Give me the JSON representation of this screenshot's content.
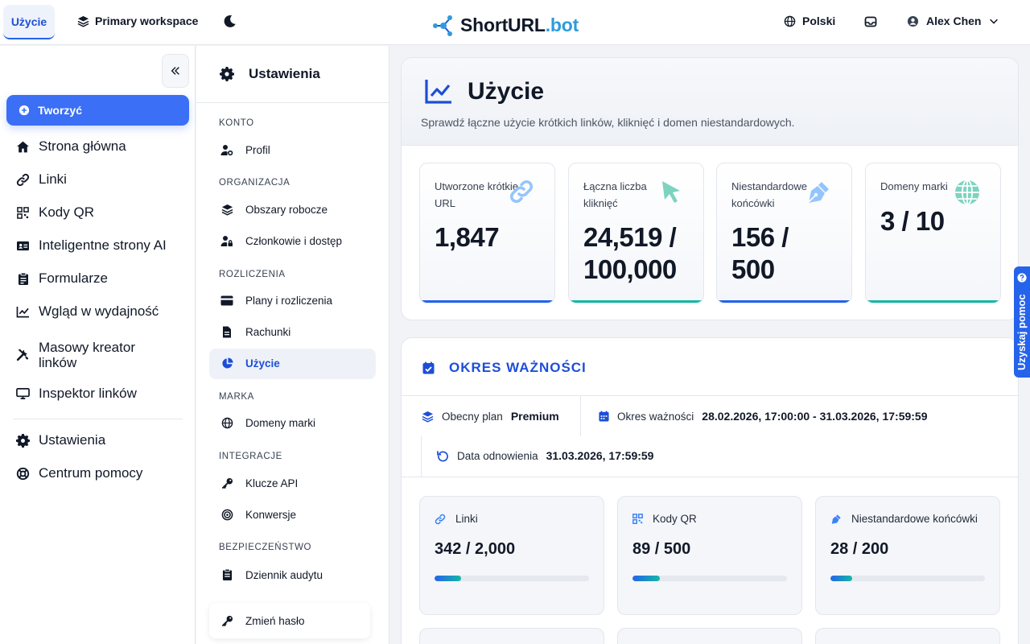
{
  "topbar": {
    "active_tab": "Użycie",
    "workspace": "Primary workspace",
    "logo_main": "ShortURL",
    "logo_dot": ".bot",
    "language": "Polski",
    "user_name": "Alex Chen"
  },
  "sidebar": {
    "create_label": "Tworzyć",
    "items": [
      {
        "label": "Strona główna",
        "icon": "home-icon"
      },
      {
        "label": "Linki",
        "icon": "link-icon"
      },
      {
        "label": "Kody QR",
        "icon": "qr-icon"
      },
      {
        "label": "Inteligentne strony AI",
        "icon": "id-card-icon"
      },
      {
        "label": "Formularze",
        "icon": "clipboard-icon"
      },
      {
        "label": "Wgląd w wydajność",
        "icon": "chart-line-icon"
      },
      {
        "label": "Masowy kreator linków",
        "icon": "tools-icon"
      },
      {
        "label": "Inspektor linków",
        "icon": "monitor-icon"
      },
      {
        "label": "Ustawienia",
        "icon": "gear-icon"
      },
      {
        "label": "Centrum pomocy",
        "icon": "lifebuoy-icon"
      }
    ]
  },
  "settings": {
    "title": "Ustawienia",
    "sections": {
      "konto": "KONTO",
      "organizacja": "ORGANIZACJA",
      "rozliczenia": "ROZLICZENIA",
      "marka": "MARKA",
      "integracje": "INTEGRACJE",
      "bezpieczenstwo": "BEZPIECZEŃSTWO"
    },
    "items": {
      "profil": "Profil",
      "obszary": "Obszary robocze",
      "czlonkowie": "Członkowie i dostęp",
      "plany": "Plany i rozliczenia",
      "rachunki": "Rachunki",
      "uzycie": "Użycie",
      "domeny": "Domeny marki",
      "klucze": "Klucze API",
      "konwersje": "Konwersje",
      "dziennik": "Dziennik audytu",
      "haslo": "Zmień hasło"
    }
  },
  "main": {
    "title": "Użycie",
    "subtitle": "Sprawdź łączne użycie krótkich linków, kliknięć i domen niestandardowych.",
    "stats": [
      {
        "label": "Utworzone krótkie URL",
        "value": "1,847",
        "color": "#2563eb"
      },
      {
        "label": "Łączna liczba kliknięć",
        "value": "24,519 / 100,000",
        "color": "#14b8a6"
      },
      {
        "label": "Niestandardowe końcówki",
        "value": "156 / 500",
        "color": "#2563eb"
      },
      {
        "label": "Domeny marki",
        "value": "3 / 10",
        "color": "#14b8a6"
      }
    ],
    "validity": {
      "title": "OKRES WAŻNOŚCI",
      "plan_label": "Obecny plan",
      "plan_value": "Premium",
      "period_label": "Okres ważności",
      "period_value": "28.02.2026, 17:00:00 - 31.03.2026, 17:59:59",
      "renewal_label": "Data odnowienia",
      "renewal_value": "31.03.2026, 17:59:59"
    },
    "usage": [
      {
        "label": "Linki",
        "value": "342 / 2,000",
        "progress": 0.171
      },
      {
        "label": "Kody QR",
        "value": "89 / 500",
        "progress": 0.178
      },
      {
        "label": "Niestandardowe końcówki",
        "value": "28 / 200",
        "progress": 0.14
      }
    ]
  },
  "help": {
    "label": "Uzyskaj pomoc"
  }
}
